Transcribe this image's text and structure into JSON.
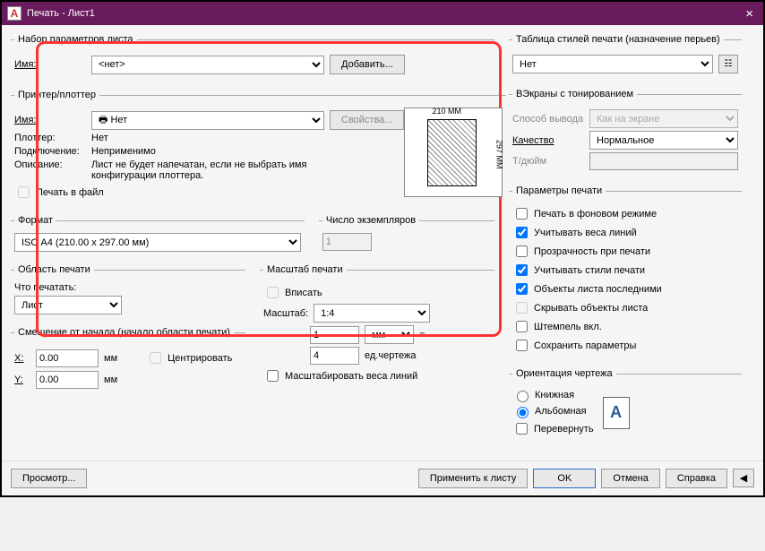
{
  "title": "Печать - Лист1",
  "pageSetup": {
    "legend": "Набор параметров листа",
    "nameLabel": "Имя:",
    "nameValue": "<нет>",
    "addBtn": "Добавить..."
  },
  "printer": {
    "legend": "Принтер/плоттер",
    "nameLabel": "Имя:",
    "nameValue": "Нет",
    "propsBtn": "Свойства...",
    "plotterLabel": "Плоттер:",
    "plotterValue": "Нет",
    "connLabel": "Подключение:",
    "connValue": "Неприменимо",
    "descLabel": "Описание:",
    "descValue": "Лист не будет напечатан, если не выбрать имя конфигурации плоттера.",
    "toFile": "Печать в файл",
    "dimW": "210 MM",
    "dimH": "297 MM"
  },
  "format": {
    "legend": "Формат",
    "value": "ISO A4 (210.00 x 297.00 мм)"
  },
  "copies": {
    "legend": "Число экземпляров",
    "value": "1"
  },
  "plotArea": {
    "legend": "Область печати",
    "whatLabel": "Что печатать:",
    "value": "Лист"
  },
  "offset": {
    "legend": "Смещение от начала (начало области печати)",
    "xLabel": "X:",
    "yLabel": "Y:",
    "x": "0.00",
    "y": "0.00",
    "unit": "мм",
    "center": "Центрировать"
  },
  "scale": {
    "legend": "Масштаб печати",
    "fit": "Вписать",
    "scaleLabel": "Масштаб:",
    "scaleValue": "1:4",
    "num1": "1",
    "unit1": "мм",
    "num2": "4",
    "unit2": "ед.чертежа",
    "lw": "Масштабировать веса линий"
  },
  "styles": {
    "legend": "Таблица стилей печати (назначение перьев)",
    "value": "Нет"
  },
  "shaded": {
    "legend": "ВЭкраны с тонированием",
    "methodLabel": "Способ вывода",
    "methodValue": "Как на экране",
    "qualityLabel": "Качество",
    "qualityValue": "Нормальное",
    "dpiLabel": "Т/дюйм"
  },
  "options": {
    "legend": "Параметры печати",
    "bg": "Печать в фоновом режиме",
    "lw": "Учитывать веса линий",
    "tr": "Прозрачность при печати",
    "ps": "Учитывать стили печати",
    "po": "Объекты листа последними",
    "hide": "Скрывать объекты листа",
    "stamp": "Штемпель вкл.",
    "save": "Сохранить параметры"
  },
  "orient": {
    "legend": "Ориентация чертежа",
    "portrait": "Книжная",
    "landscape": "Альбомная",
    "upside": "Перевернуть"
  },
  "footer": {
    "preview": "Просмотр...",
    "apply": "Применить к листу",
    "ok": "OK",
    "cancel": "Отмена",
    "help": "Справка"
  }
}
